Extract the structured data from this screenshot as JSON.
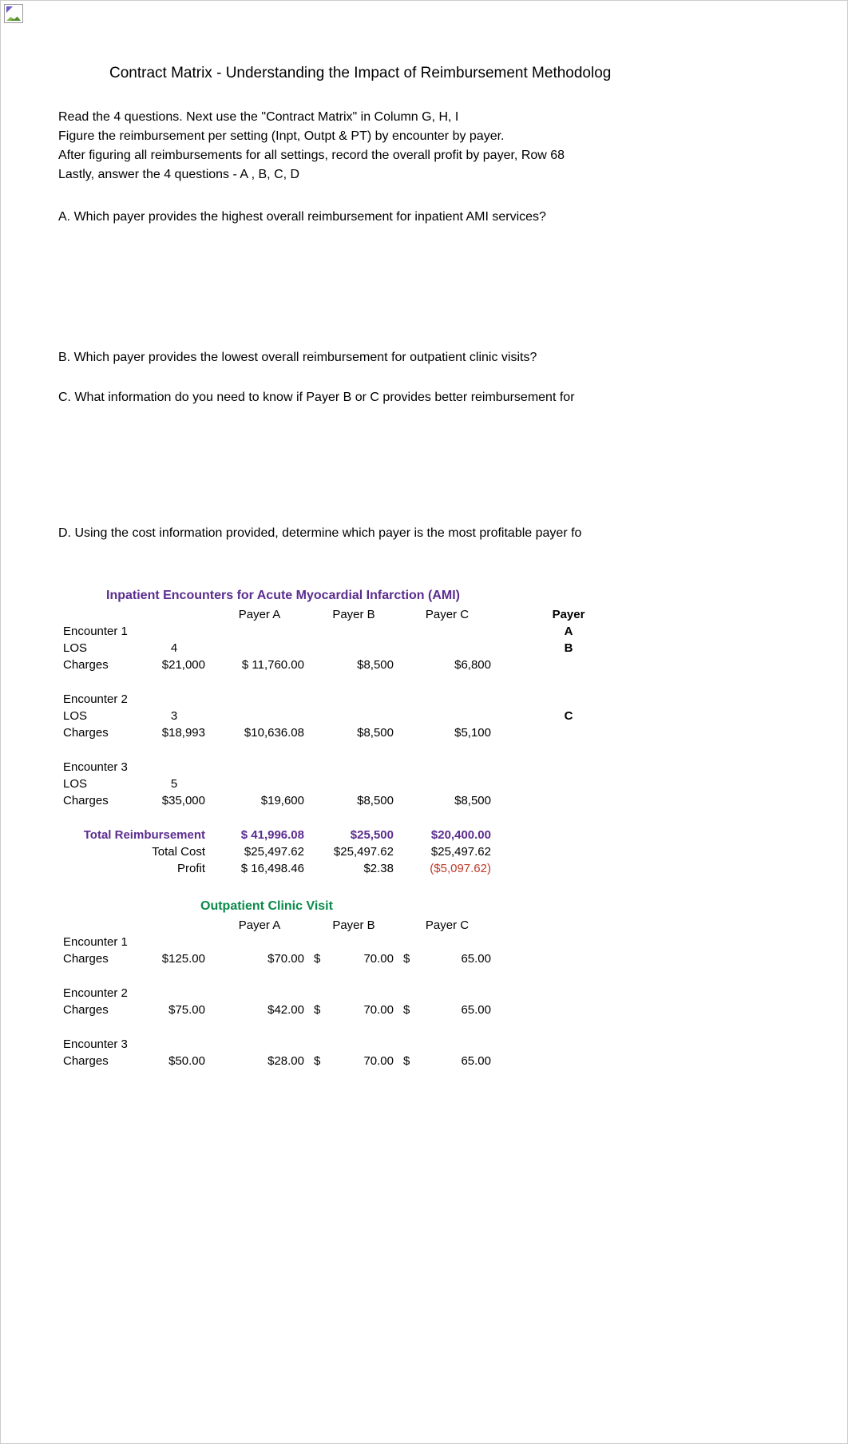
{
  "title": "Contract Matrix - Understanding the Impact of Reimbursement Methodolog",
  "instructions": [
    "Read the 4 questions.    Next use the \"Contract Matrix\" in Column G, H, I",
    "Figure the reimbursement per setting (Inpt, Outpt & PT) by encounter by payer.",
    "After figuring all reimbursements for all settings, record the overall profit by payer, Row 68",
    "Lastly, answer the 4 questions - A , B, C, D"
  ],
  "questions": {
    "A": "A.  Which payer provides the highest overall reimbursement for inpatient AMI services?",
    "B": "B.  Which payer provides the lowest overall reimbursement for outpatient clinic visits?",
    "C": "C.  What information do you need to know if Payer B or C provides better reimbursement for",
    "D": "D.  Using the cost information provided, determine which payer is the most profitable payer fo"
  },
  "sections": {
    "inpatient_title": "Inpatient Encounters for Acute Myocardial Infarction (AMI)",
    "outpatient_title": "Outpatient Clinic Visit"
  },
  "headers": {
    "payerA": "Payer A",
    "payerB": "Payer B",
    "payerC": "Payer C",
    "side_payer": "Payer",
    "side_A": "A",
    "side_B": "B",
    "side_C": "C"
  },
  "labels": {
    "encounter1": "Encounter 1",
    "encounter2": "Encounter 2",
    "encounter3": "Encounter 3",
    "los": "LOS",
    "charges": "Charges",
    "total_reimb": "Total Reimbursement",
    "total_cost": "Total Cost",
    "profit": "Profit"
  },
  "inpatient": {
    "enc1": {
      "los": "4",
      "charges": "$21,000",
      "pa": "$  11,760.00",
      "pb": "$8,500",
      "pc": "$6,800"
    },
    "enc2": {
      "los": "3",
      "charges": "$18,993",
      "pa": "$10,636.08",
      "pb": "$8,500",
      "pc": "$5,100"
    },
    "enc3": {
      "los": "5",
      "charges": "$35,000",
      "pa": "$19,600",
      "pb": "$8,500",
      "pc": "$8,500"
    },
    "total_reimb": {
      "pa": "$  41,996.08",
      "pb": "$25,500",
      "pc": "$20,400.00"
    },
    "total_cost": {
      "pa": "$25,497.62",
      "pb": "$25,497.62",
      "pc": "$25,497.62"
    },
    "profit": {
      "pa": "$  16,498.46",
      "pb": "$2.38",
      "pc": "($5,097.62)"
    }
  },
  "outpatient": {
    "enc1": {
      "charges": "$125.00",
      "pa": "$70.00",
      "pb_s": "$",
      "pb_v": "70.00",
      "pc_s": "$",
      "pc_v": "65.00"
    },
    "enc2": {
      "charges": "$75.00",
      "pa": "$42.00",
      "pb_s": "$",
      "pb_v": "70.00",
      "pc_s": "$",
      "pc_v": "65.00"
    },
    "enc3": {
      "charges": "$50.00",
      "pa": "$28.00",
      "pb_s": "$",
      "pb_v": "70.00",
      "pc_s": "$",
      "pc_v": "65.00"
    }
  },
  "chart_data": [
    {
      "type": "table",
      "title": "Inpatient Encounters for Acute Myocardial Infarction (AMI)",
      "columns": [
        "Encounter",
        "LOS",
        "Charges",
        "Payer A",
        "Payer B",
        "Payer C"
      ],
      "rows": [
        [
          "Encounter 1",
          4,
          21000,
          11760.0,
          8500,
          6800
        ],
        [
          "Encounter 2",
          3,
          18993,
          10636.08,
          8500,
          5100
        ],
        [
          "Encounter 3",
          5,
          35000,
          19600,
          8500,
          8500
        ]
      ],
      "totals": {
        "Total Reimbursement": {
          "Payer A": 41996.08,
          "Payer B": 25500,
          "Payer C": 20400.0
        },
        "Total Cost": {
          "Payer A": 25497.62,
          "Payer B": 25497.62,
          "Payer C": 25497.62
        },
        "Profit": {
          "Payer A": 16498.46,
          "Payer B": 2.38,
          "Payer C": -5097.62
        }
      }
    },
    {
      "type": "table",
      "title": "Outpatient Clinic Visit",
      "columns": [
        "Encounter",
        "Charges",
        "Payer A",
        "Payer B",
        "Payer C"
      ],
      "rows": [
        [
          "Encounter 1",
          125.0,
          70.0,
          70.0,
          65.0
        ],
        [
          "Encounter 2",
          75.0,
          42.0,
          70.0,
          65.0
        ],
        [
          "Encounter 3",
          50.0,
          28.0,
          70.0,
          65.0
        ]
      ]
    }
  ]
}
